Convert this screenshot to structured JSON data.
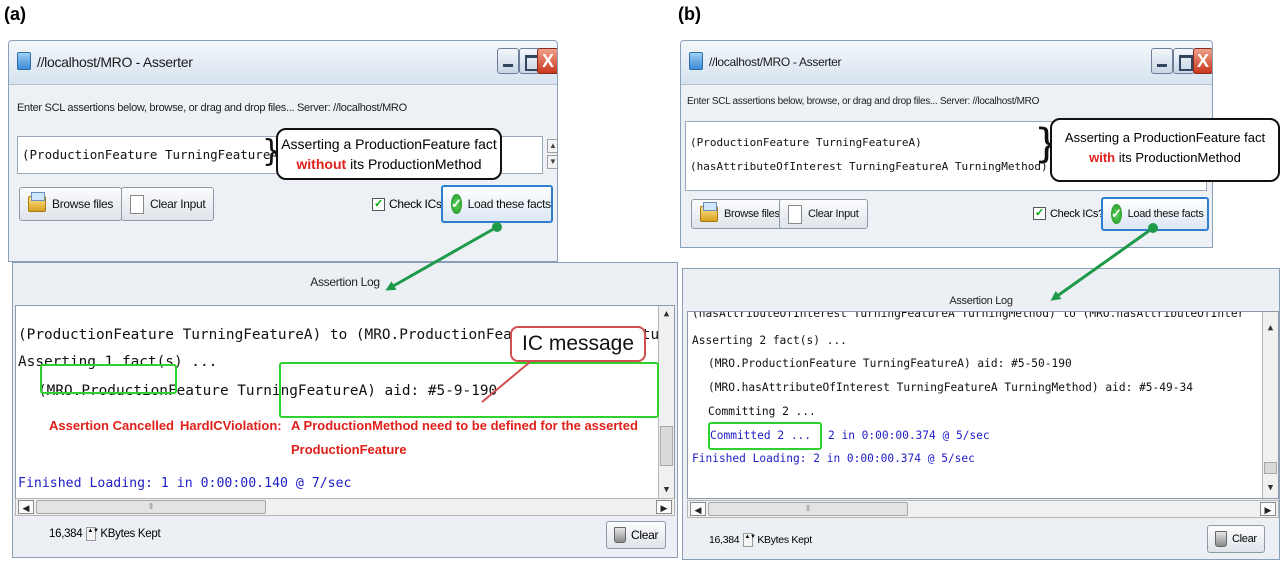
{
  "labels": {
    "a": "(a)",
    "b": "(b)"
  },
  "panel_a": {
    "window_title": "//localhost/MRO - Asserter",
    "instructions": "Enter SCL assertions below, browse, or drag and drop files... Server: //localhost/MRO",
    "input_lines": [
      "(ProductionFeature TurningFeatureA)"
    ],
    "callout": {
      "line1": "Asserting a ProductionFeature fact",
      "emph": "without",
      "rest": "its ProductionMethod"
    },
    "buttons": {
      "browse": "Browse files",
      "clear_input": "Clear Input",
      "check_ics": "Check ICs?",
      "load": "Load these facts"
    },
    "log_title": "Assertion Log",
    "log": {
      "line1": "(ProductionFeature TurningFeatureA) to (MRO.ProductionFeature TurningFeatureA)",
      "line2": "Asserting 1 fact(s) ...",
      "line3": "(MRO.ProductionFeature TurningFeatureA) aid: #5-9-190",
      "cancelled": "Assertion Cancelled",
      "violation": "HardICViolation:",
      "msg1": "A ProductionMethod need to be defined for the asserted",
      "msg2": "ProductionFeature",
      "finished": "Finished Loading: 1 in 0:00:00.140 @ 7/sec"
    },
    "ic_message": "IC message",
    "kbytes_value": "16,384",
    "kbytes_label": "KBytes Kept",
    "clear": "Clear"
  },
  "panel_b": {
    "window_title": "//localhost/MRO - Asserter",
    "instructions": "Enter SCL assertions below, browse, or drag and drop files... Server: //localhost/MRO",
    "input_lines": [
      "(ProductionFeature TurningFeatureA)",
      "(hasAttributeOfInterest TurningFeatureA TurningMethod)"
    ],
    "callout": {
      "line1": "Asserting a ProductionFeature fact",
      "emph": "with",
      "rest": "its ProductionMethod"
    },
    "buttons": {
      "browse": "Browse files",
      "clear_input": "Clear Input",
      "check_ics": "Check ICs?",
      "load": "Load these facts"
    },
    "log_title": "Assertion Log",
    "log": {
      "line0": "(hasAttributeOfInterest TurningFeatureA TurningMethod) to (MRO.hasAttributeOfInter",
      "line1": "Asserting 2 fact(s) ...",
      "line2": "(MRO.ProductionFeature TurningFeatureA) aid: #5-50-190",
      "line3": "(MRO.hasAttributeOfInterest TurningFeatureA TurningMethod) aid: #5-49-34",
      "line4": "Committing 2 ...",
      "committed_box": "Committed 2 ...",
      "committed_rest": "2 in 0:00:00.374 @ 5/sec",
      "finished": "Finished Loading: 2 in 0:00:00.374 @ 5/sec"
    },
    "kbytes_value": "16,384",
    "kbytes_label": "KBytes Kept",
    "clear": "Clear"
  },
  "colors": {
    "highlight_green": "#2ed12e",
    "emphasis_red": "#e0201a",
    "log_blue": "#2020c8"
  }
}
